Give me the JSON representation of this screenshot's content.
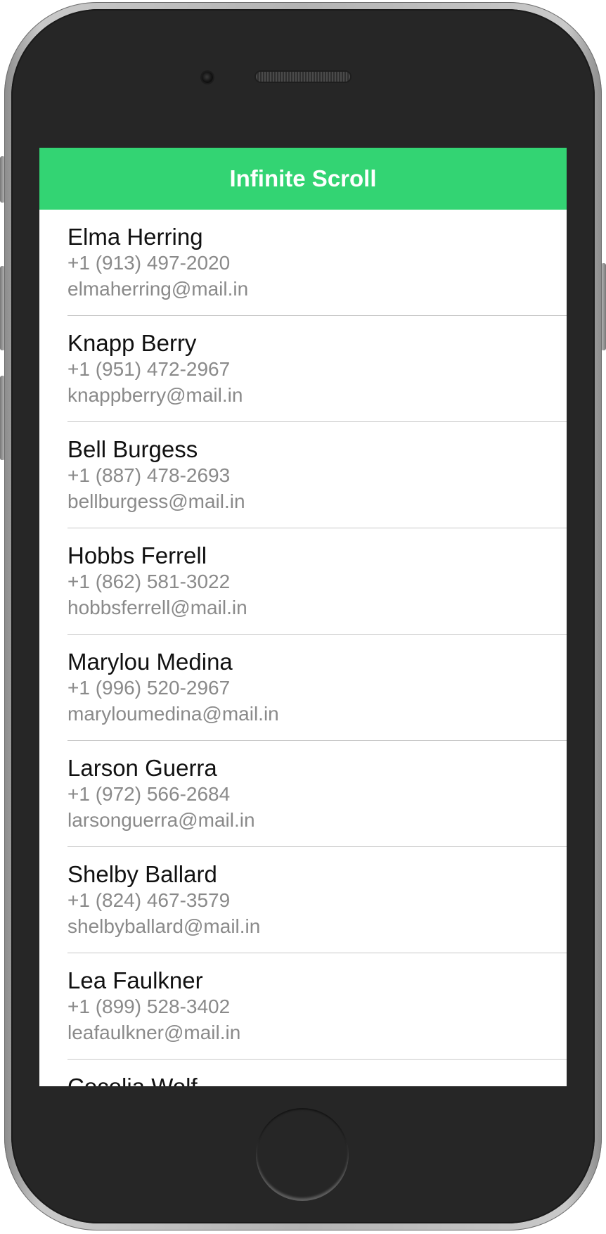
{
  "app": {
    "title": "Infinite Scroll",
    "accent_color": "#33d473"
  },
  "contacts": [
    {
      "name": "Elma Herring",
      "phone": "+1 (913) 497-2020",
      "email": "elmaherring@mail.in"
    },
    {
      "name": "Knapp Berry",
      "phone": "+1 (951) 472-2967",
      "email": "knappberry@mail.in"
    },
    {
      "name": "Bell Burgess",
      "phone": "+1 (887) 478-2693",
      "email": "bellburgess@mail.in"
    },
    {
      "name": "Hobbs Ferrell",
      "phone": "+1 (862) 581-3022",
      "email": "hobbsferrell@mail.in"
    },
    {
      "name": "Marylou Medina",
      "phone": "+1 (996) 520-2967",
      "email": "maryloumedina@mail.in"
    },
    {
      "name": "Larson Guerra",
      "phone": "+1 (972) 566-2684",
      "email": "larsonguerra@mail.in"
    },
    {
      "name": "Shelby Ballard",
      "phone": "+1 (824) 467-3579",
      "email": "shelbyballard@mail.in"
    },
    {
      "name": "Lea Faulkner",
      "phone": "+1 (899) 528-3402",
      "email": "leafaulkner@mail.in"
    },
    {
      "name": "Cecelia Wolf",
      "phone": "",
      "email": ""
    }
  ]
}
